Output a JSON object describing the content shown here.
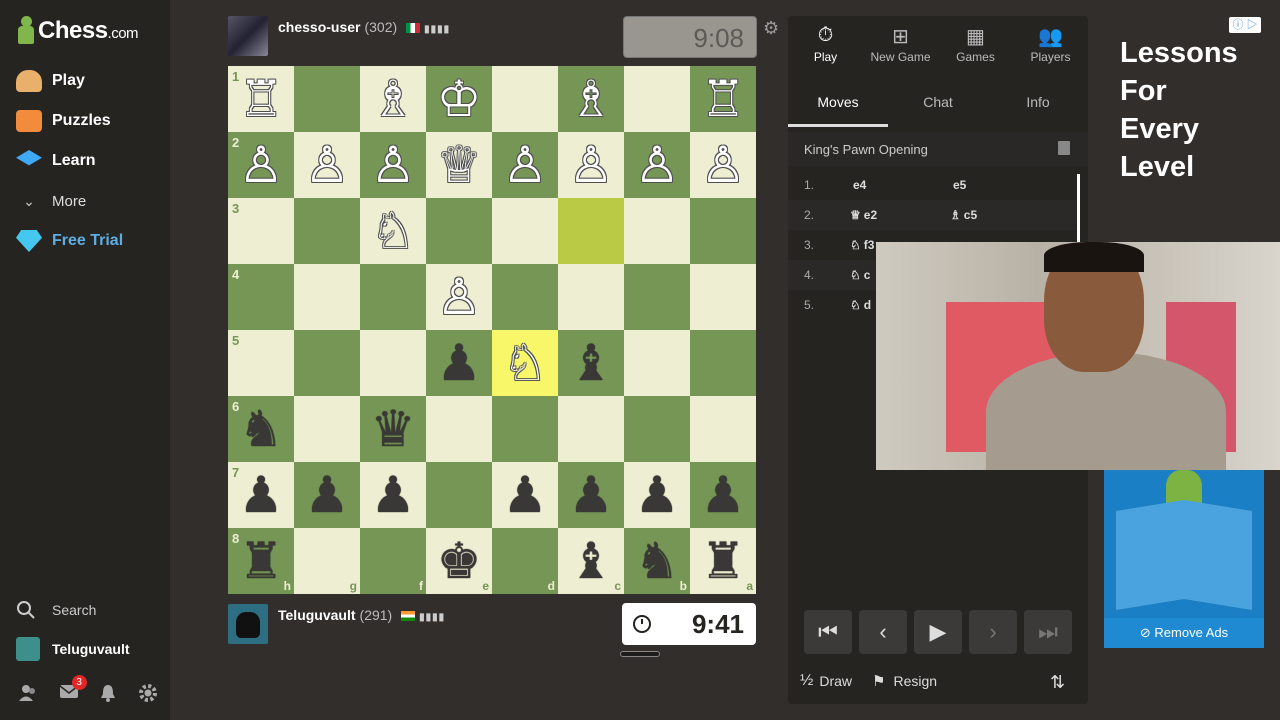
{
  "sidebar": {
    "logo_text": "Chess",
    "logo_suffix": ".com",
    "items": [
      {
        "label": "Play",
        "icon": "play-pawn-icon",
        "color": "#e8b06a"
      },
      {
        "label": "Puzzles",
        "icon": "puzzle-icon",
        "color": "#f28c3c"
      },
      {
        "label": "Learn",
        "icon": "graduation-cap-icon",
        "color": "#3fa9f5"
      },
      {
        "label": "More",
        "icon": "chevron-down-icon",
        "color": "#cccccc"
      },
      {
        "label": "Free Trial",
        "icon": "diamond-icon",
        "color": "#5dade2"
      }
    ],
    "search_label": "Search",
    "username": "Teluguvault",
    "notification_count": "3"
  },
  "top_player": {
    "name": "chesso-user",
    "rating": "(302)",
    "clock": "9:08"
  },
  "bottom_player": {
    "name": "Teluguvault",
    "rating": "(291)",
    "clock": "9:41"
  },
  "board": {
    "ranks": [
      "1",
      "2",
      "3",
      "4",
      "5",
      "6",
      "7",
      "8"
    ],
    "files": [
      "h",
      "g",
      "f",
      "e",
      "d",
      "c",
      "b",
      "a"
    ],
    "pieces": [
      [
        "♖",
        "",
        "♗",
        "♔",
        "",
        "♗",
        "",
        "♖"
      ],
      [
        "♙",
        "♙",
        "♙",
        "♕",
        "♙",
        "♙",
        "♙",
        "♙"
      ],
      [
        "",
        "",
        "♘",
        "",
        "",
        "",
        "",
        ""
      ],
      [
        "",
        "",
        "",
        "♙",
        "",
        "",
        "",
        ""
      ],
      [
        "",
        "",
        "",
        "♟",
        "♘",
        "♝",
        "",
        ""
      ],
      [
        "♞",
        "",
        "♛",
        "",
        "",
        "",
        "",
        ""
      ],
      [
        "♟",
        "♟",
        "♟",
        "",
        "♟",
        "♟",
        "♟",
        "♟"
      ],
      [
        "♜",
        "",
        "",
        "♚",
        "",
        "♝",
        "♞",
        "♜"
      ]
    ]
  },
  "panel": {
    "tabs": [
      {
        "label": "Play",
        "icon": "stopwatch-icon"
      },
      {
        "label": "New Game",
        "icon": "plus-icon"
      },
      {
        "label": "Games",
        "icon": "checkerboard-icon"
      },
      {
        "label": "Players",
        "icon": "players-icon"
      }
    ],
    "subtabs": [
      "Moves",
      "Chat",
      "Info"
    ],
    "opening": "King's Pawn Opening",
    "moves": [
      {
        "num": "1.",
        "white": "e4",
        "black": "e5",
        "white_icon": "",
        "black_icon": ""
      },
      {
        "num": "2.",
        "white": "e2",
        "black": "c5",
        "white_icon": "♕",
        "black_icon": "♗"
      },
      {
        "num": "3.",
        "white": "f3",
        "black": "",
        "white_icon": "♘",
        "black_icon": ""
      },
      {
        "num": "4.",
        "white": "c",
        "black": "",
        "white_icon": "♘",
        "black_icon": ""
      },
      {
        "num": "5.",
        "white": "d",
        "black": "",
        "white_icon": "♘",
        "black_icon": ""
      }
    ],
    "draw_label": "Draw",
    "draw_prefix": "½",
    "resign_label": "Resign"
  },
  "ad": {
    "lines": [
      "Lessons",
      "For",
      "Every",
      "Level"
    ],
    "remove_ads": "Remove Ads"
  }
}
